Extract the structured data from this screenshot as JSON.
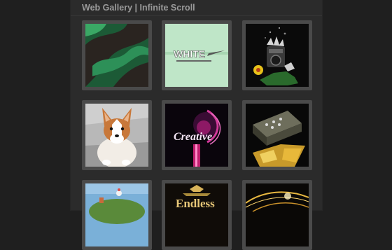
{
  "page": {
    "title": "Web Gallery | Infinite Scroll"
  },
  "gallery": {
    "items": [
      {
        "subject": "green abstract swirl"
      },
      {
        "subject": "white logo text",
        "text": "WHITE"
      },
      {
        "subject": "camera splash"
      },
      {
        "subject": "corgi dog"
      },
      {
        "subject": "pink creative typography",
        "text": "Creative"
      },
      {
        "subject": "vintage typewriter"
      },
      {
        "subject": "planet island"
      },
      {
        "subject": "ornate text",
        "text": "Endless"
      },
      {
        "subject": "golden light streaks"
      }
    ]
  }
}
